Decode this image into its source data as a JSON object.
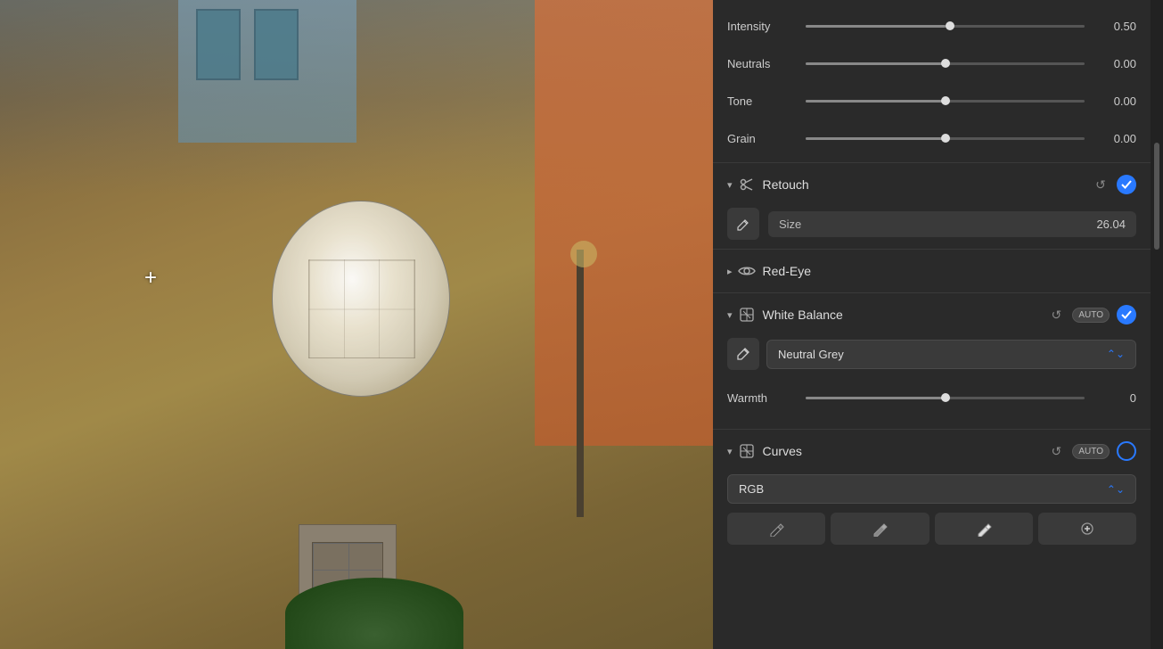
{
  "photo": {
    "alt": "Building photo with retouch overlay"
  },
  "sliders": {
    "intensity": {
      "label": "Intensity",
      "value": 0.5,
      "value_display": "0.50",
      "fill_pct": 50,
      "thumb_pct": 50
    },
    "neutrals": {
      "label": "Neutrals",
      "value": 0.0,
      "value_display": "0.00",
      "fill_pct": 50,
      "thumb_pct": 50
    },
    "tone": {
      "label": "Tone",
      "value": 0.0,
      "value_display": "0.00",
      "fill_pct": 50,
      "thumb_pct": 50
    },
    "grain": {
      "label": "Grain",
      "value": 0.0,
      "value_display": "0.00",
      "fill_pct": 50,
      "thumb_pct": 50
    }
  },
  "sections": {
    "retouch": {
      "title": "Retouch",
      "icon": "✂",
      "expanded": true,
      "size_label": "Size",
      "size_value": "26.04",
      "reset_icon": "↺",
      "check": true
    },
    "red_eye": {
      "title": "Red-Eye",
      "icon": "👁",
      "expanded": false
    },
    "white_balance": {
      "title": "White Balance",
      "icon": "⊠",
      "expanded": true,
      "auto_badge": "AUTO",
      "reset_icon": "↺",
      "check": true,
      "dropdown_value": "Neutral Grey",
      "warmth_label": "Warmth",
      "warmth_value": "0",
      "warmth_fill_pct": 50,
      "warmth_thumb_pct": 50
    },
    "curves": {
      "title": "Curves",
      "icon": "⊠",
      "expanded": true,
      "auto_badge": "AUTO",
      "reset_icon": "↺",
      "dropdown_value": "RGB",
      "tool1": "✏",
      "tool2": "✏",
      "tool3": "✏",
      "tool4": "✛"
    }
  },
  "toolbar": {
    "tool_pencil1": "pencil-light-icon",
    "tool_pencil2": "pencil-mid-icon",
    "tool_pencil3": "pencil-dark-icon",
    "tool_crosshair": "crosshair-icon"
  }
}
